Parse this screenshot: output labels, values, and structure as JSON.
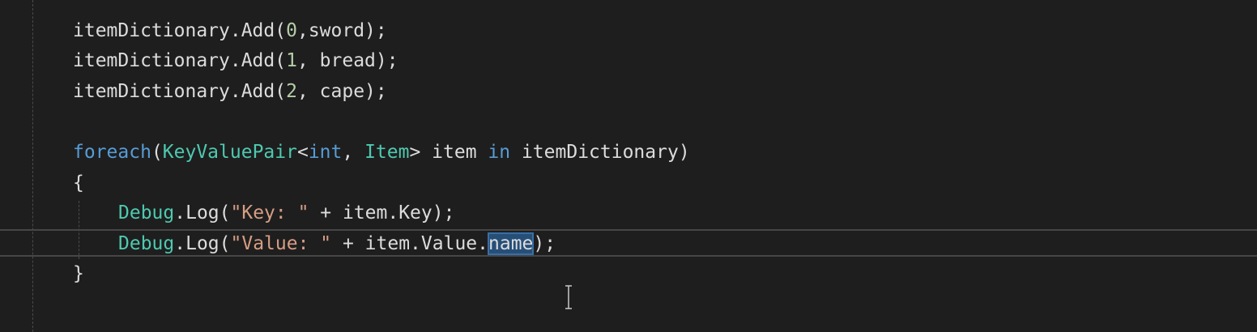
{
  "editor": {
    "colors": {
      "background": "#1e1e1e",
      "keyword": "#569cd6",
      "type": "#4ec9b0",
      "string": "#d69d85",
      "number": "#b5cea8",
      "text": "#dcdcdc",
      "selection": "#264f78"
    },
    "lines": [
      {
        "line_label": "line-1",
        "tokens": [
          {
            "text": "itemDictionary.Add(",
            "kind": "default"
          },
          {
            "text": "0",
            "kind": "number"
          },
          {
            "text": ",sword);",
            "kind": "default"
          }
        ]
      },
      {
        "line_label": "line-2",
        "tokens": [
          {
            "text": "itemDictionary.Add(",
            "kind": "default"
          },
          {
            "text": "1",
            "kind": "number"
          },
          {
            "text": ", bread);",
            "kind": "default"
          }
        ]
      },
      {
        "line_label": "line-3",
        "tokens": [
          {
            "text": "itemDictionary.Add(",
            "kind": "default"
          },
          {
            "text": "2",
            "kind": "number"
          },
          {
            "text": ", cape);",
            "kind": "default"
          }
        ]
      },
      {
        "line_label": "line-5",
        "tokens": [
          {
            "text": "foreach",
            "kind": "keyword"
          },
          {
            "text": "(",
            "kind": "default"
          },
          {
            "text": "KeyValuePair",
            "kind": "type"
          },
          {
            "text": "<",
            "kind": "default"
          },
          {
            "text": "int",
            "kind": "keyword"
          },
          {
            "text": ", ",
            "kind": "default"
          },
          {
            "text": "Item",
            "kind": "type"
          },
          {
            "text": "> item ",
            "kind": "default"
          },
          {
            "text": "in",
            "kind": "keyword"
          },
          {
            "text": " itemDictionary)",
            "kind": "default"
          }
        ]
      },
      {
        "line_label": "line-6",
        "tokens": [
          {
            "text": "{",
            "kind": "default"
          }
        ]
      },
      {
        "line_label": "line-7",
        "tokens": [
          {
            "text": "Debug",
            "kind": "class"
          },
          {
            "text": ".Log(",
            "kind": "default"
          },
          {
            "text": "\"Key: \"",
            "kind": "string"
          },
          {
            "text": " + item.Key);",
            "kind": "default"
          }
        ]
      },
      {
        "line_label": "line-8",
        "tokens": [
          {
            "text": "Debug",
            "kind": "class"
          },
          {
            "text": ".Log(",
            "kind": "default"
          },
          {
            "text": "\"Value: \"",
            "kind": "string"
          },
          {
            "text": " + item.Value.",
            "kind": "default"
          },
          {
            "text": "name",
            "kind": "selected"
          },
          {
            "text": ");",
            "kind": "default"
          }
        ]
      },
      {
        "line_label": "line-9",
        "tokens": [
          {
            "text": "}",
            "kind": "default"
          }
        ]
      }
    ]
  }
}
